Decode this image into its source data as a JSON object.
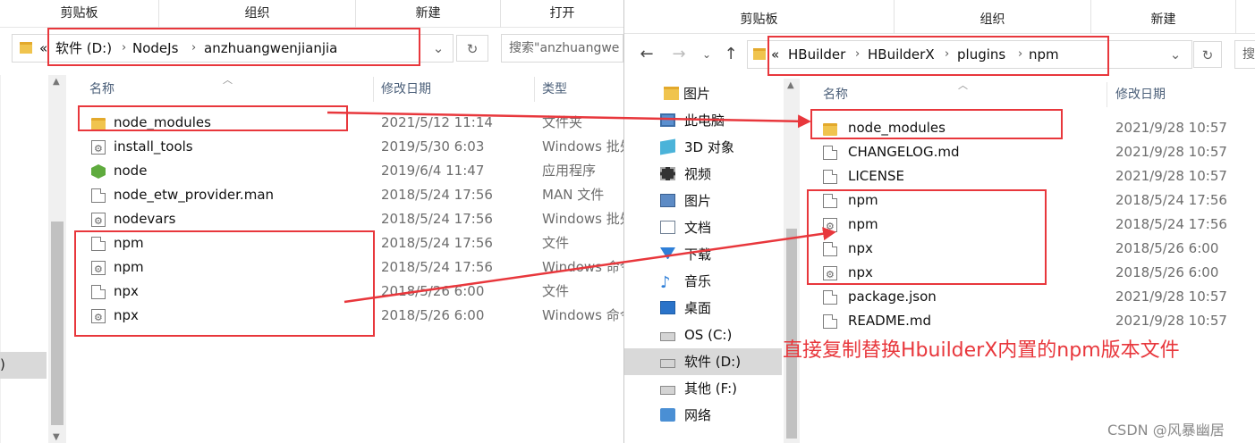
{
  "left": {
    "ribbon": [
      "剪贴板",
      "组织",
      "新建",
      "打开"
    ],
    "address": {
      "overflow": "«",
      "crumbs": [
        "软件 (D:)",
        "NodeJs",
        "anzhuangwenjianjia"
      ]
    },
    "search": "搜索\"anzhuangwe",
    "columns": {
      "name": "名称",
      "date": "修改日期",
      "type": "类型"
    },
    "files": [
      {
        "name": "node_modules",
        "date": "2021/5/12 11:14",
        "type": "文件夹",
        "icon": "folder-icon"
      },
      {
        "name": "install_tools",
        "date": "2019/5/30 6:03",
        "type": "Windows 批处",
        "icon": "batch-file-icon"
      },
      {
        "name": "node",
        "date": "2019/6/4 11:47",
        "type": "应用程序",
        "icon": "node-app-icon"
      },
      {
        "name": "node_etw_provider.man",
        "date": "2018/5/24 17:56",
        "type": "MAN 文件",
        "icon": "file-icon"
      },
      {
        "name": "nodevars",
        "date": "2018/5/24 17:56",
        "type": "Windows 批处",
        "icon": "batch-file-icon"
      },
      {
        "name": "npm",
        "date": "2018/5/24 17:56",
        "type": "文件",
        "icon": "file-icon"
      },
      {
        "name": "npm",
        "date": "2018/5/24 17:56",
        "type": "Windows 命令",
        "icon": "batch-file-icon"
      },
      {
        "name": "npx",
        "date": "2018/5/26 6:00",
        "type": "文件",
        "icon": "file-icon"
      },
      {
        "name": "npx",
        "date": "2018/5/26 6:00",
        "type": "Windows 命令",
        "icon": "batch-file-icon"
      }
    ],
    "nav_fragment": ")"
  },
  "right": {
    "ribbon": [
      "剪贴板",
      "组织",
      "新建"
    ],
    "address": {
      "overflow": "«",
      "crumbs": [
        "HBuilder",
        "HBuilderX",
        "plugins",
        "npm"
      ]
    },
    "nav": [
      {
        "label": "图片",
        "icon": "folder-icon"
      },
      {
        "label": "此电脑",
        "icon": "computer-icon"
      },
      {
        "label": "3D 对象",
        "icon": "3d-objects-icon"
      },
      {
        "label": "视频",
        "icon": "video-icon"
      },
      {
        "label": "图片",
        "icon": "picture-icon"
      },
      {
        "label": "文档",
        "icon": "document-icon"
      },
      {
        "label": "下载",
        "icon": "download-icon"
      },
      {
        "label": "音乐",
        "icon": "music-icon"
      },
      {
        "label": "桌面",
        "icon": "desktop-icon"
      },
      {
        "label": "OS (C:)",
        "icon": "drive-icon"
      },
      {
        "label": "软件 (D:)",
        "icon": "drive-icon",
        "selected": true
      },
      {
        "label": "其他 (F:)",
        "icon": "drive-icon"
      },
      {
        "label": "网络",
        "icon": "network-icon"
      }
    ],
    "columns": {
      "name": "名称",
      "date": "修改日期"
    },
    "files": [
      {
        "name": "node_modules",
        "date": "2021/9/28 10:57",
        "icon": "folder-icon"
      },
      {
        "name": "CHANGELOG.md",
        "date": "2021/9/28 10:57",
        "icon": "file-icon"
      },
      {
        "name": "LICENSE",
        "date": "2021/9/28 10:57",
        "icon": "file-icon"
      },
      {
        "name": "npm",
        "date": "2018/5/24 17:56",
        "icon": "file-icon"
      },
      {
        "name": "npm",
        "date": "2018/5/24 17:56",
        "icon": "batch-file-icon"
      },
      {
        "name": "npx",
        "date": "2018/5/26 6:00",
        "icon": "file-icon"
      },
      {
        "name": "npx",
        "date": "2018/5/26 6:00",
        "icon": "batch-file-icon"
      },
      {
        "name": "package.json",
        "date": "2021/9/28 10:57",
        "icon": "file-icon"
      },
      {
        "name": "README.md",
        "date": "2021/9/28 10:57",
        "icon": "file-icon"
      }
    ]
  },
  "annotation": "直接复制替换HbuilderX内置的npm版本文件",
  "watermark": "CSDN @风暴幽居",
  "colors": {
    "highlight": "#e8373c",
    "selected_nav": "#d9d9d9",
    "folder": "#f0c44e"
  }
}
